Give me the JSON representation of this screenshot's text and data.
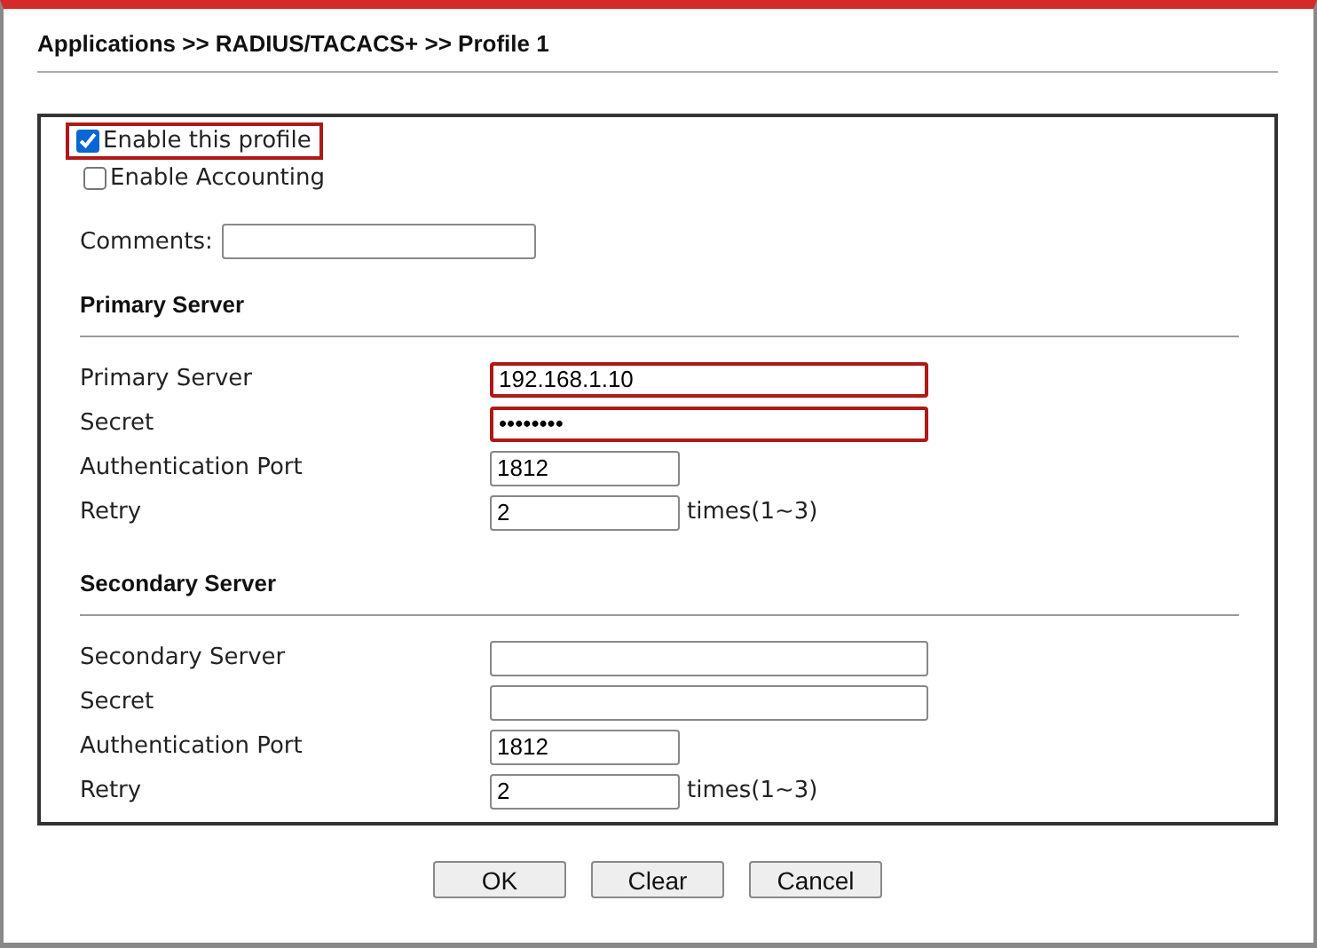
{
  "breadcrumb": "Applications >> RADIUS/TACACS+ >> Profile 1",
  "options": [
    {
      "label": "Enable this profile",
      "checked": true,
      "highlighted": true
    },
    {
      "label": "Enable Accounting",
      "checked": false,
      "highlighted": false
    }
  ],
  "comments": {
    "label": "Comments:"
  },
  "sections": [
    {
      "title": "Primary Server",
      "fields": [
        {
          "label": "Primary Server",
          "value": "192.168.1.10",
          "kind": "wide",
          "highlighted": true
        },
        {
          "label": "Secret",
          "value": "••••••••",
          "kind": "wide",
          "highlighted": true
        },
        {
          "label": "Authentication Port",
          "value": "1812",
          "kind": "short",
          "highlighted": false
        },
        {
          "label": "Retry",
          "value": "2",
          "kind": "short",
          "highlighted": false,
          "suffix": "times(1~3)"
        }
      ]
    },
    {
      "title": "Secondary Server",
      "fields": [
        {
          "label": "Secondary Server",
          "kind": "wide",
          "highlighted": false
        },
        {
          "label": "Secret",
          "kind": "wide",
          "highlighted": false
        },
        {
          "label": "Authentication Port",
          "value": "1812",
          "kind": "short",
          "highlighted": false
        },
        {
          "label": "Retry",
          "value": "2",
          "kind": "short",
          "highlighted": false,
          "suffix": "times(1~3)"
        }
      ]
    }
  ],
  "buttons": [
    "OK",
    "Clear",
    "Cancel"
  ]
}
